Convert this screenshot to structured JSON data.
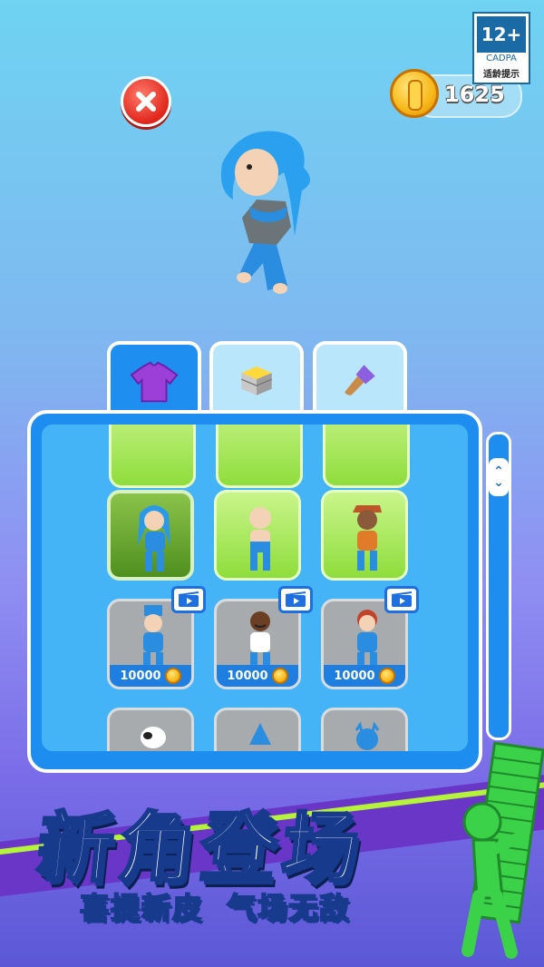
{
  "header": {
    "coins": "1625",
    "age_rating": {
      "rating": "12+",
      "org": "CADPA",
      "hint": "适龄提示"
    }
  },
  "tabs": [
    {
      "id": "outfit",
      "active": true
    },
    {
      "id": "blocks",
      "active": false
    },
    {
      "id": "paint",
      "active": false
    }
  ],
  "grid": {
    "row_partial_top": [
      {
        "state": "green"
      },
      {
        "state": "green"
      },
      {
        "state": "green"
      }
    ],
    "row_owned": [
      {
        "state": "selected",
        "skin": "blue-hair"
      },
      {
        "state": "green",
        "skin": "bald-blue"
      },
      {
        "state": "green",
        "skin": "worker-hat"
      }
    ],
    "row_locked": [
      {
        "price": "10000",
        "skin": "blue-cap",
        "video": true
      },
      {
        "price": "10000",
        "skin": "mustache-cap",
        "video": true
      },
      {
        "price": "10000",
        "skin": "red-hair",
        "video": true
      }
    ],
    "row_partial_bottom": [
      {
        "skin": "cow-mask"
      },
      {
        "skin": "shark-hood"
      },
      {
        "skin": "devil-horns"
      }
    ]
  },
  "banner": {
    "title": "新角登场",
    "subtitle_left": "喜提新皮",
    "subtitle_right": "气场无敌"
  },
  "colors": {
    "accent": "#1d8ef0",
    "banner_text_stroke": "#173a8c",
    "green_card": "#8fdd3c"
  },
  "icons": [
    "close-icon",
    "coin-icon",
    "tshirt-icon",
    "block-icon",
    "paint-brush-icon",
    "video-ad-icon",
    "scroll-arrows-icon"
  ]
}
